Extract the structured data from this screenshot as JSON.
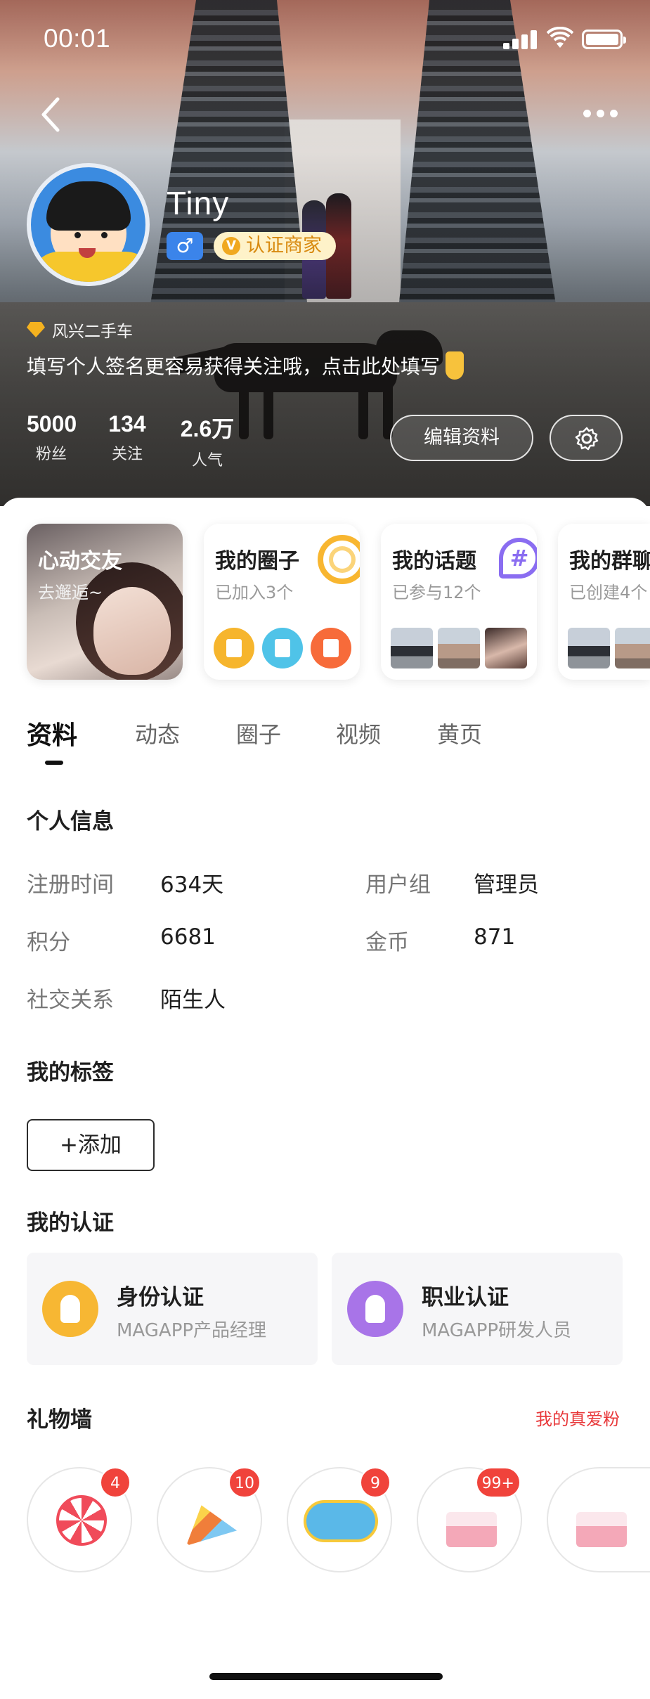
{
  "status_bar": {
    "time": "00:01"
  },
  "profile": {
    "name": "Tiny",
    "gender_symbol": "♂",
    "merchant_badge": "认证商家",
    "merchant_badge_icon": "V",
    "level_label": "风兴二手车",
    "signature": "填写个人签名更容易获得关注哦，点击此处填写"
  },
  "stats": [
    {
      "value": "5000",
      "label": "粉丝"
    },
    {
      "value": "134",
      "label": "关注"
    },
    {
      "value": "2.6万",
      "label": "人气"
    }
  ],
  "actions": {
    "edit_profile": "编辑资料"
  },
  "cards": [
    {
      "title": "心动交友",
      "subtitle": "去邂逅~"
    },
    {
      "title": "我的圈子",
      "subtitle": "已加入3个"
    },
    {
      "title": "我的话题",
      "subtitle": "已参与12个"
    },
    {
      "title": "我的群聊",
      "subtitle": "已创建4个"
    }
  ],
  "tabs": [
    "资料",
    "动态",
    "圈子",
    "视频",
    "黄页"
  ],
  "personal_info": {
    "title": "个人信息",
    "rows": [
      {
        "key": "注册时间",
        "value": "634天"
      },
      {
        "key": "用户组",
        "value": "管理员"
      },
      {
        "key": "积分",
        "value": "6681"
      },
      {
        "key": "金币",
        "value": "871"
      },
      {
        "key": "社交关系",
        "value": "陌生人"
      }
    ]
  },
  "tags": {
    "title": "我的标签",
    "add_label": "添加",
    "add_icon": "+"
  },
  "certification": {
    "title": "我的认证",
    "items": [
      {
        "title": "身份认证",
        "subtitle": "MAGAPP产品经理",
        "color": "#f7b733"
      },
      {
        "title": "职业认证",
        "subtitle": "MAGAPP研发人员",
        "color": "#a874e8"
      }
    ]
  },
  "gifts": {
    "title": "礼物墙",
    "link": "我的真爱粉",
    "items": [
      {
        "name": "lollipop-icon",
        "count": "4"
      },
      {
        "name": "party-popper-icon",
        "count": "10"
      },
      {
        "name": "cool-icon",
        "count": "9"
      },
      {
        "name": "cake-icon",
        "count": "99+"
      },
      {
        "name": "cake-icon",
        "count": ""
      }
    ]
  },
  "colors": {
    "accent_red": "#e8383a",
    "gender_blue": "#3b84ea",
    "merchant_gold": "#f0a820"
  }
}
